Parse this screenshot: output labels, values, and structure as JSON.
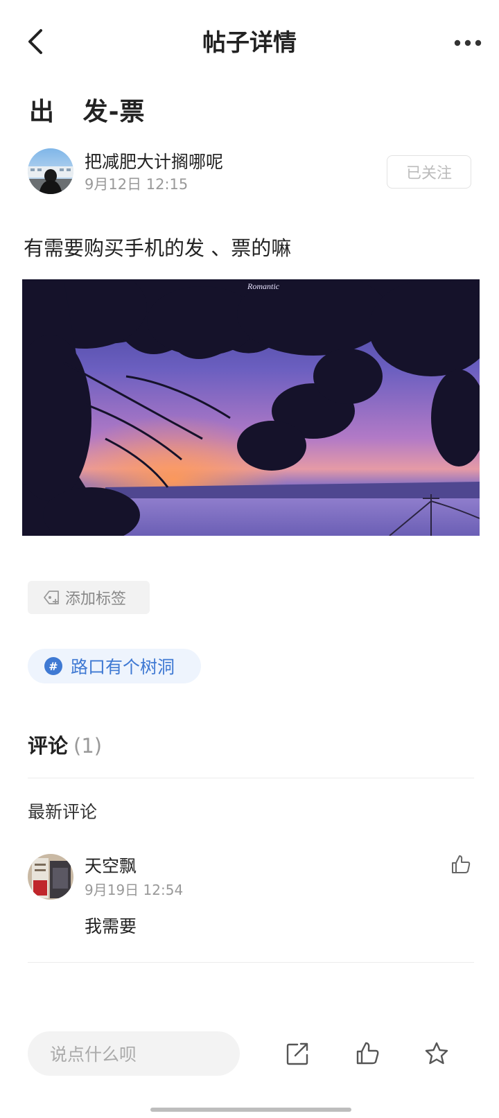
{
  "nav": {
    "title": "帖子详情",
    "back_icon": "chevron-left-icon",
    "more_icon": "more-dots-icon"
  },
  "post": {
    "title": "出   发-票",
    "author": {
      "name": "把减肥大计搁哪呢",
      "time": "9月12日 12:15",
      "follow_label": "已关注"
    },
    "text": "有需要购买手机的发 、票的嘛",
    "image": {
      "watermark": "Romantic"
    },
    "add_tag_label": "添加标签",
    "topic": {
      "icon_glyph": "#",
      "label": "路口有个树洞"
    }
  },
  "comments": {
    "heading": "评论",
    "count": "(1)",
    "latest_label": "最新评论",
    "items": [
      {
        "name": "天空飘",
        "time": "9月19日 12:54",
        "text": "我需要"
      }
    ]
  },
  "bottom_bar": {
    "input_placeholder": "说点什么呗",
    "icons": [
      "share-icon",
      "thumbs-up-icon",
      "star-icon"
    ]
  },
  "colors": {
    "accent_blue": "#3f79d3",
    "topic_bg": "#eef4fd",
    "muted_text": "#999999"
  }
}
